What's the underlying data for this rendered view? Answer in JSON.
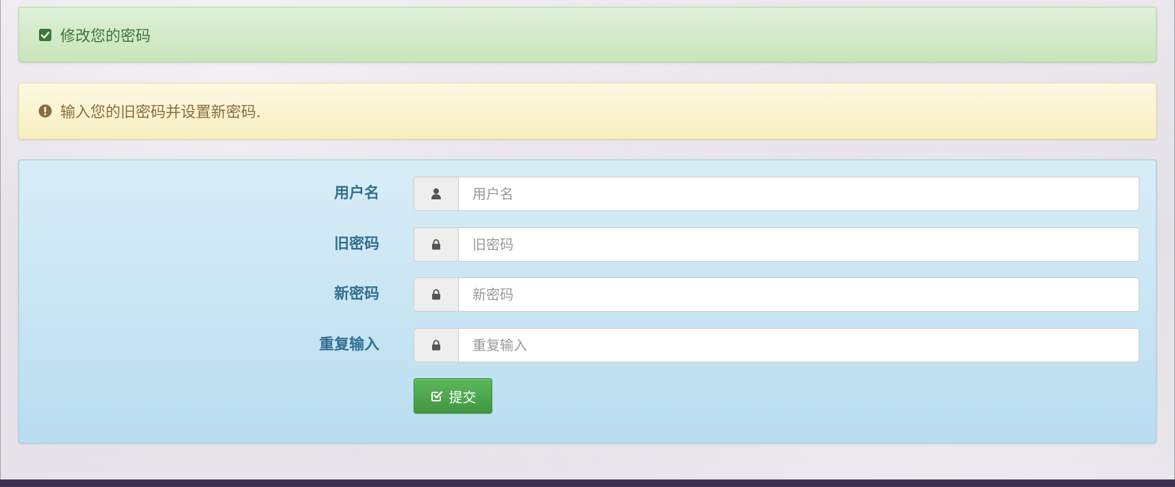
{
  "success_alert": {
    "icon": "check-square-icon",
    "text": "修改您的密码",
    "color": "#3c763d"
  },
  "warning_alert": {
    "icon": "exclamation-circle-icon",
    "text": "输入您的旧密码并设置新密码.",
    "color": "#8a6d3b"
  },
  "form": {
    "fields": [
      {
        "label": "用户名",
        "icon": "user-icon",
        "placeholder": "用户名",
        "value": ""
      },
      {
        "label": "旧密码",
        "icon": "lock-icon",
        "placeholder": "旧密码",
        "value": ""
      },
      {
        "label": "新密码",
        "icon": "lock-icon",
        "placeholder": "新密码",
        "value": ""
      },
      {
        "label": "重复输入",
        "icon": "lock-icon",
        "placeholder": "重复输入",
        "value": ""
      }
    ],
    "submit": {
      "icon": "check-square-outline-icon",
      "label": "提交",
      "color": "#5cb85c"
    }
  },
  "colors": {
    "label_text": "#31708f",
    "panel_bg": "#d9edf7",
    "success_bg": "#dff0d8",
    "warning_bg": "#fcf8e3"
  }
}
